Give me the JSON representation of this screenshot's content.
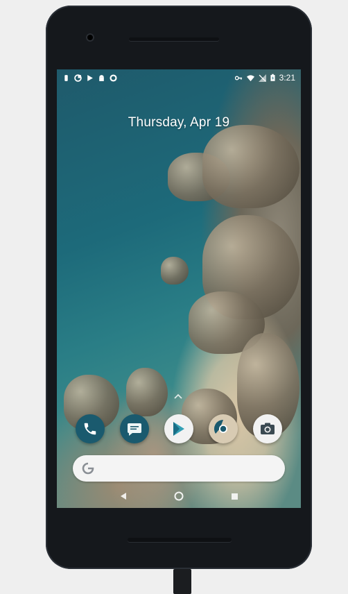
{
  "status_bar": {
    "time": "3:21",
    "left_icons": [
      "notification-icon",
      "data-saver-icon",
      "play-store-icon",
      "android-icon",
      "circle-icon"
    ],
    "right_icons": [
      "vpn-key-icon",
      "wifi-icon",
      "no-sim-icon",
      "battery-charging-icon"
    ]
  },
  "lock_screen": {
    "date": "Thursday, Apr 19"
  },
  "dock": {
    "apps": [
      {
        "name": "Phone",
        "icon": "phone-icon",
        "color": "#1a5a6e"
      },
      {
        "name": "Messages",
        "icon": "messages-icon",
        "color": "#1a5a6e"
      },
      {
        "name": "Play Store",
        "icon": "play-store-icon",
        "color": "#f2f2f2"
      },
      {
        "name": "Chrome",
        "icon": "chrome-icon",
        "color": "#d8cbb3"
      },
      {
        "name": "Camera",
        "icon": "camera-icon",
        "color": "#f2f2f2"
      }
    ]
  },
  "search_bar": {
    "icon": "google-g-icon"
  },
  "nav_bar": {
    "buttons": [
      "back-icon",
      "home-icon",
      "recents-icon"
    ]
  },
  "colors": {
    "phone_body": "#15181c",
    "accent_teal": "#1a5a6e"
  }
}
